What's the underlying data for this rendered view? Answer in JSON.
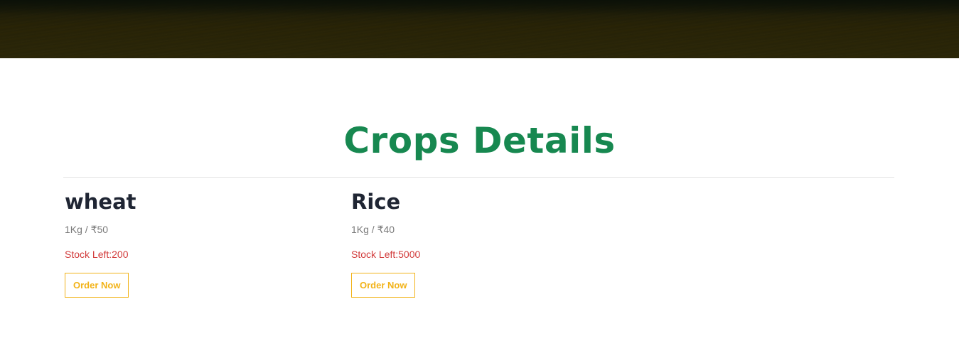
{
  "section": {
    "title": "Crops Details"
  },
  "crops": [
    {
      "name": "wheat",
      "price": "1Kg / ₹50",
      "stock": "Stock Left:200",
      "order_label": "Order Now"
    },
    {
      "name": "Rice",
      "price": "1Kg / ₹40",
      "stock": "Stock Left:5000",
      "order_label": "Order Now"
    }
  ],
  "colors": {
    "title": "#178850",
    "crop_name": "#1f2533",
    "price": "#7a7a7a",
    "stock": "#d23b3b",
    "button_accent": "#f2b319",
    "hero_overlay": "#2b2a0c"
  }
}
